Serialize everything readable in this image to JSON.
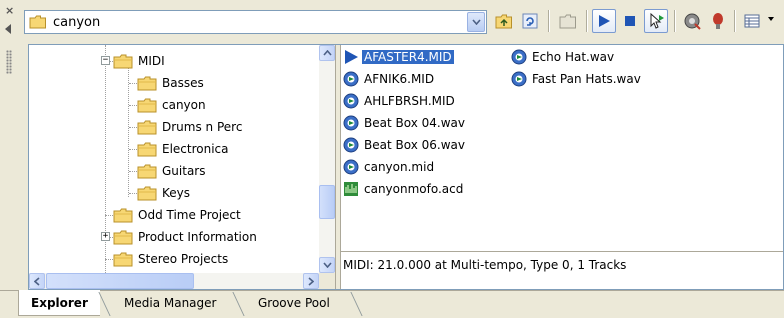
{
  "toolbar": {
    "address_value": "canyon",
    "buttons": [
      {
        "name": "up-folder-icon"
      },
      {
        "name": "refresh-icon"
      },
      {
        "name": "new-folder-icon"
      },
      {
        "name": "play-icon"
      },
      {
        "name": "stop-icon"
      },
      {
        "name": "auto-preview-icon"
      },
      {
        "name": "add-to-project-icon"
      },
      {
        "name": "favorites-icon"
      },
      {
        "name": "views-icon"
      }
    ]
  },
  "tree": {
    "items": [
      {
        "label": "MIDI",
        "expander": "−"
      },
      {
        "label": "Basses"
      },
      {
        "label": "canyon"
      },
      {
        "label": "Drums n Perc"
      },
      {
        "label": "Electronica"
      },
      {
        "label": "Guitars"
      },
      {
        "label": "Keys"
      },
      {
        "label": "Odd Time Project"
      },
      {
        "label": "Product Information",
        "expander": "+"
      },
      {
        "label": "Stereo Projects"
      }
    ]
  },
  "files": {
    "items": [
      {
        "name": "AFASTER4.MID",
        "icon": "play-triangle-icon",
        "selected": true
      },
      {
        "name": "AFNIK6.MID",
        "icon": "audio-file-icon"
      },
      {
        "name": "AHLFBRSH.MID",
        "icon": "audio-file-icon"
      },
      {
        "name": "Beat Box 04.wav",
        "icon": "audio-file-icon"
      },
      {
        "name": "Beat Box 06.wav",
        "icon": "audio-file-icon"
      },
      {
        "name": "canyon.mid",
        "icon": "audio-file-icon"
      },
      {
        "name": "canyonmofo.acd",
        "icon": "acid-project-icon"
      },
      {
        "name": "Echo Hat.wav",
        "icon": "audio-file-icon"
      },
      {
        "name": "Fast Pan Hats.wav",
        "icon": "audio-file-icon"
      }
    ]
  },
  "status": {
    "text": "MIDI: 21.0.000 at Multi-tempo, Type 0, 1 Tracks"
  },
  "tabs": [
    {
      "label": "Explorer",
      "active": true
    },
    {
      "label": "Media Manager"
    },
    {
      "label": "Groove Pool"
    }
  ],
  "colors": {
    "selection": "#316ac5",
    "folder": "#f7d774",
    "panel_border": "#7f9db9",
    "chrome": "#ece9d8"
  }
}
